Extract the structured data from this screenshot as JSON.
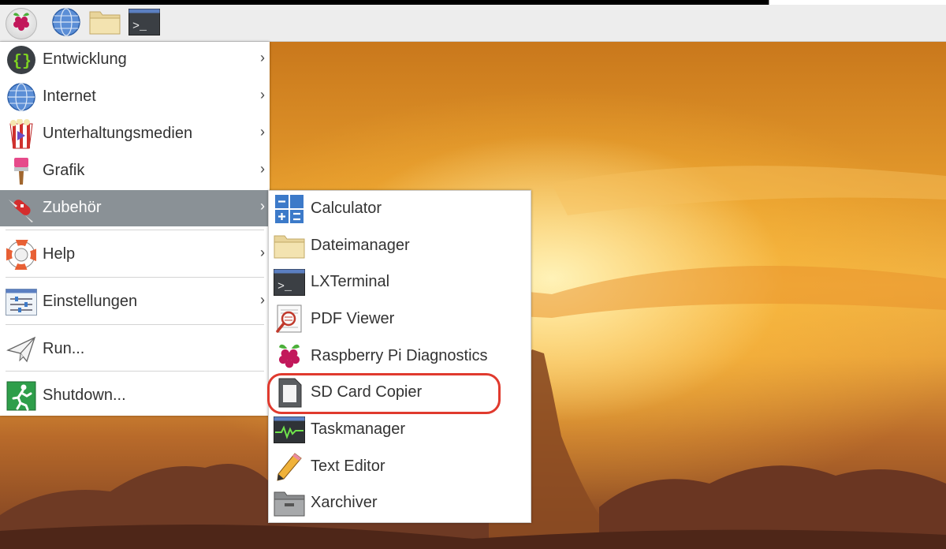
{
  "taskbar": {
    "launchers": [
      {
        "name": "raspberry-menu",
        "icon": "raspberry-icon"
      },
      {
        "name": "web-browser",
        "icon": "globe-icon"
      },
      {
        "name": "file-manager",
        "icon": "folder-icon"
      },
      {
        "name": "terminal",
        "icon": "terminal-icon"
      }
    ]
  },
  "main_menu": {
    "items": [
      {
        "label": "Entwicklung",
        "icon": "braces-icon",
        "has_submenu": true
      },
      {
        "label": "Internet",
        "icon": "globe-icon",
        "has_submenu": true
      },
      {
        "label": "Unterhaltungsmedien",
        "icon": "popcorn-icon",
        "has_submenu": true
      },
      {
        "label": "Grafik",
        "icon": "paintbrush-icon",
        "has_submenu": true
      },
      {
        "label": "Zubehör",
        "icon": "swiss-knife-icon",
        "has_submenu": true,
        "active": true
      },
      {
        "label": "Help",
        "icon": "lifebuoy-icon",
        "has_submenu": true
      },
      {
        "label": "Einstellungen",
        "icon": "sliders-icon",
        "has_submenu": true
      },
      {
        "label": "Run...",
        "icon": "paper-plane-icon",
        "has_submenu": false
      },
      {
        "label": "Shutdown...",
        "icon": "exit-icon",
        "has_submenu": false
      }
    ],
    "arrow": "›"
  },
  "sub_menu": {
    "items": [
      {
        "label": "Calculator",
        "icon": "calculator-icon"
      },
      {
        "label": "Dateimanager",
        "icon": "folder-icon"
      },
      {
        "label": "LXTerminal",
        "icon": "terminal-icon"
      },
      {
        "label": "PDF Viewer",
        "icon": "pdf-viewer-icon"
      },
      {
        "label": "Raspberry Pi Diagnostics",
        "icon": "raspberry-icon"
      },
      {
        "label": "SD Card Copier",
        "icon": "sd-card-icon",
        "highlighted": true
      },
      {
        "label": "Taskmanager",
        "icon": "task-monitor-icon"
      },
      {
        "label": "Text Editor",
        "icon": "pencil-icon"
      },
      {
        "label": "Xarchiver",
        "icon": "archive-box-icon"
      }
    ]
  },
  "colors": {
    "active_item_bg": "#8a9196",
    "highlight_ring": "#e03a2e"
  }
}
